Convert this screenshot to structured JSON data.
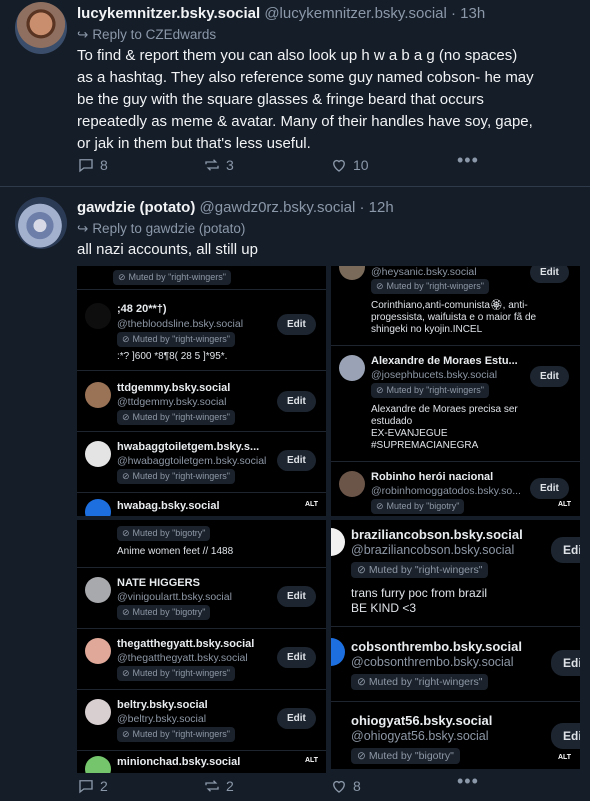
{
  "post1": {
    "display_name": "lucykemnitzer.bsky.social",
    "handle_time": "@lucykemnitzer.bsky.social · 13h",
    "reply_to": "Reply to CZEdwards",
    "text_lines": [
      "To find & report them you can also look up h w a b a g (no spaces)",
      "as a hashtag. They also reference some guy named cobson- he may",
      "be the guy with the square glasses & fringe beard that occurs",
      "repeatedly as meme & avatar. Many of their handles have soy, gape,",
      "or jak in them but that's less useful."
    ],
    "reply_count": "8",
    "repost_count": "3",
    "like_count": "10"
  },
  "post2": {
    "display_name": "gawdzie (potato)",
    "handle_time": "@gawdz0rz.bsky.social · 12h",
    "reply_to": "Reply to gawdzie (potato)",
    "text": "all nazi accounts, all still up",
    "reply_count": "2",
    "repost_count": "2",
    "like_count": "8"
  },
  "screenshots": {
    "top_left": {
      "rows": [
        {
          "name": "",
          "handle": "",
          "muted": "Muted by \"right-wingers\"",
          "edit": "",
          "body": ""
        },
        {
          "name": ";48 20**†)",
          "handle": "@thebloodsline.bsky.social",
          "muted": "Muted by \"right-wingers\"",
          "edit": "Edit",
          "body": ":*? ]600 *8¶8( 28 5 ]*95*."
        },
        {
          "name": "ttdgemmy.bsky.social",
          "handle": "@ttdgemmy.bsky.social",
          "muted": "Muted by \"right-wingers\"",
          "edit": "Edit",
          "body": ""
        },
        {
          "name": "hwabaggtoiletgem.bsky.s...",
          "handle": "@hwabaggtoiletgem.bsky.social",
          "muted": "Muted by \"right-wingers\"",
          "edit": "Edit",
          "body": ""
        },
        {
          "name": "hwabag.bsky.social",
          "handle": "",
          "muted": "",
          "edit": "",
          "body": ""
        }
      ],
      "alt": "ALT"
    },
    "top_right": {
      "rows": [
        {
          "name": "",
          "handle": "@heysanic.bsky.social",
          "muted": "Muted by \"right-wingers\"",
          "edit": "Edit",
          "body": "Corinthiano,anti-comunista🏵, anti-\nprogessista, waifuista e o maior fã de\nshingeki no kyojin.INCEL"
        },
        {
          "name": "Alexandre de Moraes Estu...",
          "handle": "@josephbucets.bsky.social",
          "muted": "Muted by \"right-wingers\"",
          "edit": "Edit",
          "body": "Alexandre de Moraes precisa ser\nestudado\nEX-EVANJEGUE\n#SUPREMACIANEGRA"
        },
        {
          "name": "Robinho herói nacional",
          "handle": "@robinhomoggatodos.bsky.so...",
          "muted": "Muted by \"bigotry\"",
          "edit": "Edit",
          "body": ""
        }
      ],
      "alt": "ALT"
    },
    "bottom_left": {
      "rows": [
        {
          "name": "",
          "handle": "",
          "muted": "Muted by \"bigotry\"",
          "edit": "",
          "body": "Anime women feet // 1488"
        },
        {
          "name": "NATE HIGGERS",
          "handle": "@vinigoulartt.bsky.social",
          "muted": "Muted by \"bigotry\"",
          "edit": "Edit",
          "body": ""
        },
        {
          "name": "thegatthegyatt.bsky.social",
          "handle": "@thegatthegyatt.bsky.social",
          "muted": "Muted by \"right-wingers\"",
          "edit": "Edit",
          "body": ""
        },
        {
          "name": "beltry.bsky.social",
          "handle": "@beltry.bsky.social",
          "muted": "Muted by \"right-wingers\"",
          "edit": "Edit",
          "body": ""
        },
        {
          "name": "minionchad.bsky.social",
          "handle": "",
          "muted": "",
          "edit": "",
          "body": ""
        }
      ],
      "alt": "ALT"
    },
    "bottom_right": {
      "rows": [
        {
          "name": "braziliancobson.bsky.social",
          "handle": "@braziliancobson.bsky.social",
          "muted": "Muted by \"right-wingers\"",
          "edit": "Edi",
          "body": "trans furry poc from brazil\nBE KIND <3"
        },
        {
          "name": "cobsonthrembo.bsky.social",
          "handle": "@cobsonthrembo.bsky.social",
          "muted": "Muted by \"right-wingers\"",
          "edit": "Edi",
          "body": ""
        },
        {
          "name": "ohiogyat56.bsky.social",
          "handle": "@ohiogyat56.bsky.social",
          "muted": "Muted by \"bigotry\"",
          "edit": "Edi",
          "body": ""
        }
      ],
      "alt": "ALT"
    }
  },
  "icons": {
    "reply": "reply-arrow-icon",
    "comment": "comment-bubble-icon",
    "repost": "repost-arrows-icon",
    "like": "heart-icon",
    "more": "ellipsis-icon",
    "muted": "mute-icon"
  },
  "colors": {
    "background": "#151d28",
    "text_primary": "#f1f3f5",
    "text_secondary": "#8b98a9",
    "screenshot_bg": "#000000"
  }
}
